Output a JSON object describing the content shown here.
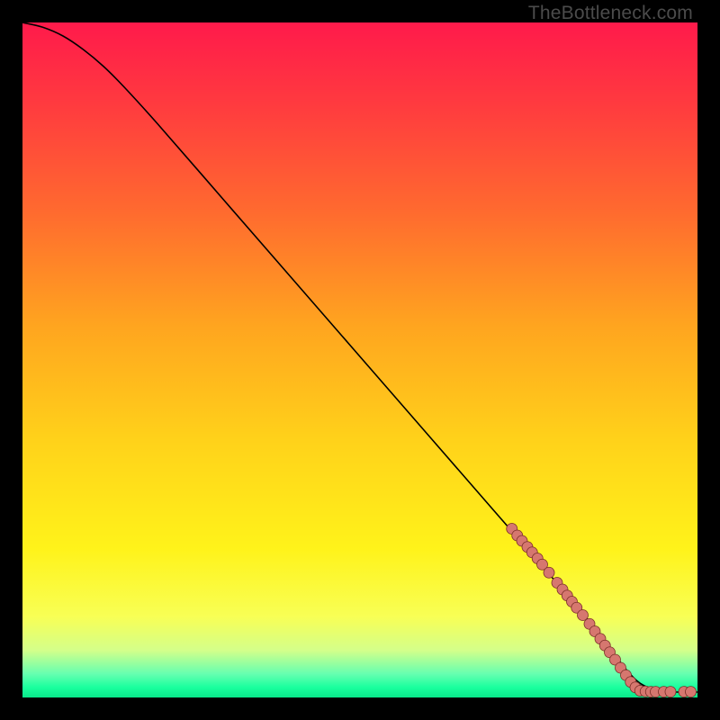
{
  "watermark": "TheBottleneck.com",
  "chart_data": {
    "type": "line",
    "title": "",
    "xlabel": "",
    "ylabel": "",
    "xlim": [
      0,
      100
    ],
    "ylim": [
      0,
      100
    ],
    "grid": false,
    "legend": false,
    "gradient_stops": [
      {
        "offset": 0.0,
        "color": "#ff1a4b"
      },
      {
        "offset": 0.12,
        "color": "#ff3a3f"
      },
      {
        "offset": 0.28,
        "color": "#ff6a2f"
      },
      {
        "offset": 0.45,
        "color": "#ffa51f"
      },
      {
        "offset": 0.62,
        "color": "#ffd21a"
      },
      {
        "offset": 0.78,
        "color": "#fff31a"
      },
      {
        "offset": 0.88,
        "color": "#f8ff55"
      },
      {
        "offset": 0.93,
        "color": "#d4ff8a"
      },
      {
        "offset": 0.965,
        "color": "#66ffb0"
      },
      {
        "offset": 0.985,
        "color": "#1aff9e"
      },
      {
        "offset": 1.0,
        "color": "#09e88a"
      }
    ],
    "series": [
      {
        "name": "bottleneck-curve",
        "color": "#000000",
        "x": [
          0,
          3,
          6,
          9,
          12,
          15,
          20,
          30,
          40,
          50,
          60,
          70,
          80,
          85,
          88,
          90,
          92,
          95,
          100
        ],
        "y": [
          100,
          99.3,
          98.0,
          96.0,
          93.5,
          90.5,
          85.0,
          73.5,
          62.0,
          50.5,
          39.0,
          27.5,
          16.0,
          10.0,
          6.0,
          3.5,
          1.8,
          0.9,
          0.8
        ]
      }
    ],
    "markers": {
      "color": "#d6776f",
      "radius_px": 6,
      "stroke": "#7a2e28",
      "points": [
        {
          "x": 72.5,
          "y": 25.0
        },
        {
          "x": 73.3,
          "y": 24.0
        },
        {
          "x": 74.0,
          "y": 23.2
        },
        {
          "x": 74.8,
          "y": 22.3
        },
        {
          "x": 75.5,
          "y": 21.5
        },
        {
          "x": 76.3,
          "y": 20.6
        },
        {
          "x": 77.0,
          "y": 19.7
        },
        {
          "x": 78.0,
          "y": 18.5
        },
        {
          "x": 79.2,
          "y": 17.0
        },
        {
          "x": 80.0,
          "y": 16.0
        },
        {
          "x": 80.7,
          "y": 15.1
        },
        {
          "x": 81.4,
          "y": 14.2
        },
        {
          "x": 82.1,
          "y": 13.3
        },
        {
          "x": 83.0,
          "y": 12.2
        },
        {
          "x": 84.0,
          "y": 10.9
        },
        {
          "x": 84.8,
          "y": 9.8
        },
        {
          "x": 85.6,
          "y": 8.7
        },
        {
          "x": 86.3,
          "y": 7.7
        },
        {
          "x": 87.0,
          "y": 6.7
        },
        {
          "x": 87.8,
          "y": 5.6
        },
        {
          "x": 88.6,
          "y": 4.4
        },
        {
          "x": 89.4,
          "y": 3.3
        },
        {
          "x": 90.1,
          "y": 2.3
        },
        {
          "x": 90.8,
          "y": 1.5
        },
        {
          "x": 91.5,
          "y": 1.0
        },
        {
          "x": 92.3,
          "y": 0.9
        },
        {
          "x": 93.1,
          "y": 0.85
        },
        {
          "x": 93.8,
          "y": 0.85
        },
        {
          "x": 95.0,
          "y": 0.85
        },
        {
          "x": 96.0,
          "y": 0.85
        },
        {
          "x": 98.0,
          "y": 0.85
        },
        {
          "x": 99.0,
          "y": 0.85
        }
      ]
    }
  }
}
